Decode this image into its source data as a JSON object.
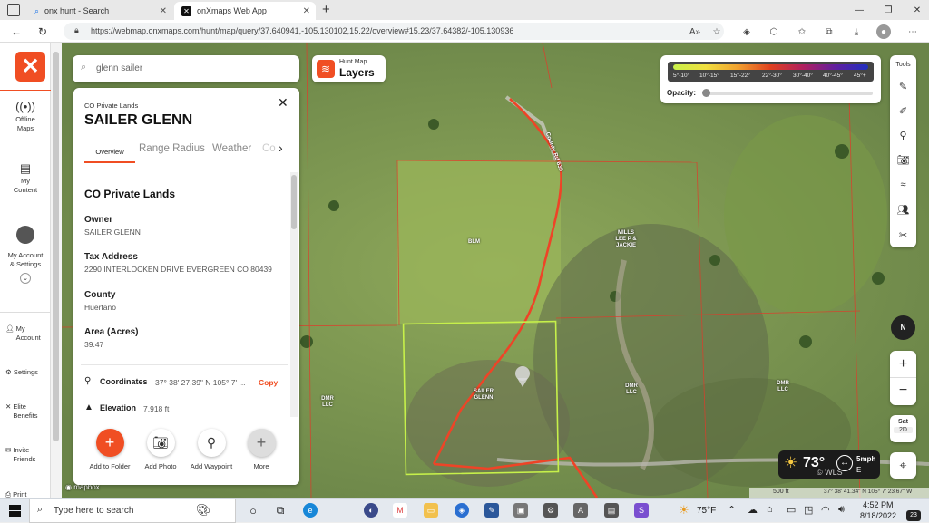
{
  "browser": {
    "tabs": [
      {
        "title": "onx hunt - Search",
        "active": false
      },
      {
        "title": "onXmaps Web App",
        "active": true
      }
    ],
    "url": "https://webmap.onxmaps.com/hunt/map/query/37.640941,-105.130102,15.22/overview#15.23/37.64382/-105.130936"
  },
  "sidebar": {
    "items": [
      {
        "label": "Offline Maps",
        "icon": "offline-maps-icon"
      },
      {
        "label": "My Content",
        "icon": "my-content-icon"
      },
      {
        "label": "My Account & Settings",
        "icon": "avatar-icon"
      }
    ],
    "small_items": [
      {
        "label": "My Account",
        "icon": "user-icon"
      },
      {
        "label": "Settings",
        "icon": "gear-icon"
      },
      {
        "label": "Elite Benefits",
        "icon": "close-icon"
      },
      {
        "label": "Invite Friends",
        "icon": "share-icon"
      },
      {
        "label": "Print",
        "icon": "print-icon"
      }
    ]
  },
  "search": {
    "value": "glenn sailer"
  },
  "layers_button": {
    "small": "Hunt Map",
    "big": "Layers"
  },
  "panel": {
    "category": "CO Private Lands",
    "title": "SAILER GLENN",
    "tabs": [
      "Overview",
      "Range Radius",
      "Weather",
      "Co"
    ],
    "section_title": "CO Private Lands",
    "fields": [
      {
        "label": "Owner",
        "value": "SAILER GLENN"
      },
      {
        "label": "Tax Address",
        "value": "2290 INTERLOCKEN DRIVE EVERGREEN CO 80439"
      },
      {
        "label": "County",
        "value": "Huerfano"
      },
      {
        "label": "Area (Acres)",
        "value": "39.47"
      }
    ],
    "coordinates_label": "Coordinates",
    "coordinates_value": "37° 38' 27.39\" N 105° 7' ...",
    "copy_label": "Copy",
    "elevation_label": "Elevation",
    "elevation_value": "7,918 ft",
    "actions": [
      "Add to Folder",
      "Add Photo",
      "Add Waypoint",
      "More"
    ]
  },
  "legend": {
    "ranges": [
      "5°-10°",
      "10°-15°",
      "15°-22°",
      "22°-30°",
      "30°-40°",
      "40°-45°",
      "45°+"
    ],
    "opacity_label": "Opacity:",
    "opacity": 0
  },
  "tools": {
    "label": "Tools",
    "compass": "N",
    "zoom_in": "+",
    "zoom_out": "−",
    "mode_top": "Sat",
    "mode_bottom": "2D"
  },
  "weather": {
    "temp": "73°",
    "wind": "5mph",
    "dir": "E",
    "credit": "© WLS"
  },
  "map": {
    "road": "County Rd 630",
    "labels": [
      "BLM",
      "MILLS LEE P & JACKIE",
      "SAILER GLENN",
      "DMR LLC",
      "DMR LLC",
      "DMR LLC"
    ],
    "scale": "500 ft",
    "coords": "37° 38' 41.34\" N 105° 7' 23.67\" W",
    "attribution": "mapbox"
  },
  "taskbar": {
    "search_placeholder": "Type here to search",
    "temp": "75°F",
    "time": "4:52 PM",
    "date": "8/18/2022",
    "notif": "23"
  }
}
